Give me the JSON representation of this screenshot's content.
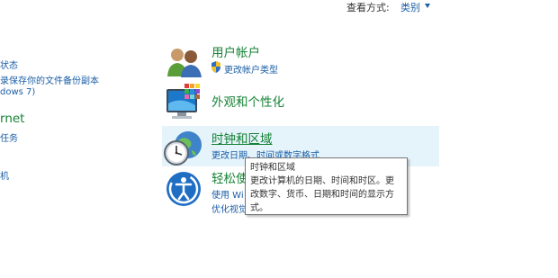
{
  "header": {
    "view_by_label": "查看方式:",
    "view_by_value": "类别"
  },
  "left_column": {
    "item1": "状态",
    "item2": "录保存你的文件备份副本",
    "item3": "dows 7)",
    "heading": "rnet",
    "item4": "任务",
    "item5": "机"
  },
  "categories": {
    "user_accounts": {
      "title": "用户帐户",
      "link1": "更改帐户类型"
    },
    "appearance": {
      "title": "外观和个性化"
    },
    "clock_region": {
      "title": "时钟和区域",
      "link1": "更改日期、时间或数字格式"
    },
    "ease_of_access": {
      "title": "轻松使",
      "link1": "使用 Wi",
      "link2": "优化视觉"
    }
  },
  "tooltip": {
    "line1": "时钟和区域",
    "line2": "更改计算机的日期、时间和时区。更",
    "line3": "改数字、货币、日期和时间的显示方",
    "line4": "式。"
  },
  "colors": {
    "category_title": "#178236",
    "link": "#1a5ea6",
    "hover_bg": "#e5f3fb"
  }
}
